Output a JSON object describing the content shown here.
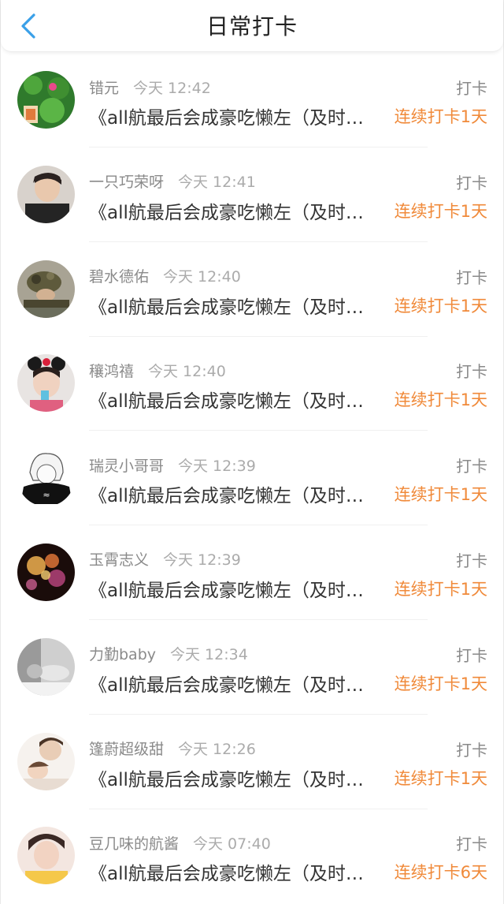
{
  "header": {
    "title": "日常打卡",
    "back_icon": "chevron-left-icon",
    "accent": "#3aa0e8"
  },
  "colors": {
    "streak": "#f08a3a"
  },
  "items": [
    {
      "name": "错元",
      "time": "今天 12:42",
      "tag": "打卡",
      "post": "《all航最后会成豪吃懒左（及时…",
      "streak": "连续打卡1天"
    },
    {
      "name": "一只巧荣呀",
      "time": "今天 12:41",
      "tag": "打卡",
      "post": "《all航最后会成豪吃懒左（及时…",
      "streak": "连续打卡1天"
    },
    {
      "name": "碧水德佑",
      "time": "今天 12:40",
      "tag": "打卡",
      "post": "《all航最后会成豪吃懒左（及时…",
      "streak": "连续打卡1天"
    },
    {
      "name": "穰鸿禧",
      "time": "今天 12:40",
      "tag": "打卡",
      "post": "《all航最后会成豪吃懒左（及时…",
      "streak": "连续打卡1天"
    },
    {
      "name": "瑞灵小哥哥",
      "time": "今天 12:39",
      "tag": "打卡",
      "post": "《all航最后会成豪吃懒左（及时…",
      "streak": "连续打卡1天"
    },
    {
      "name": "玉霄志义",
      "time": "今天 12:39",
      "tag": "打卡",
      "post": "《all航最后会成豪吃懒左（及时…",
      "streak": "连续打卡1天"
    },
    {
      "name": "力勤baby",
      "time": "今天 12:34",
      "tag": "打卡",
      "post": "《all航最后会成豪吃懒左（及时…",
      "streak": "连续打卡1天"
    },
    {
      "name": "篷蔚超级甜",
      "time": "今天 12:26",
      "tag": "打卡",
      "post": "《all航最后会成豪吃懒左（及时…",
      "streak": "连续打卡1天"
    },
    {
      "name": "豆几味的航酱",
      "time": "今天 07:40",
      "tag": "打卡",
      "post": "《all航最后会成豪吃懒左（及时…",
      "streak": "连续打卡6天"
    }
  ]
}
